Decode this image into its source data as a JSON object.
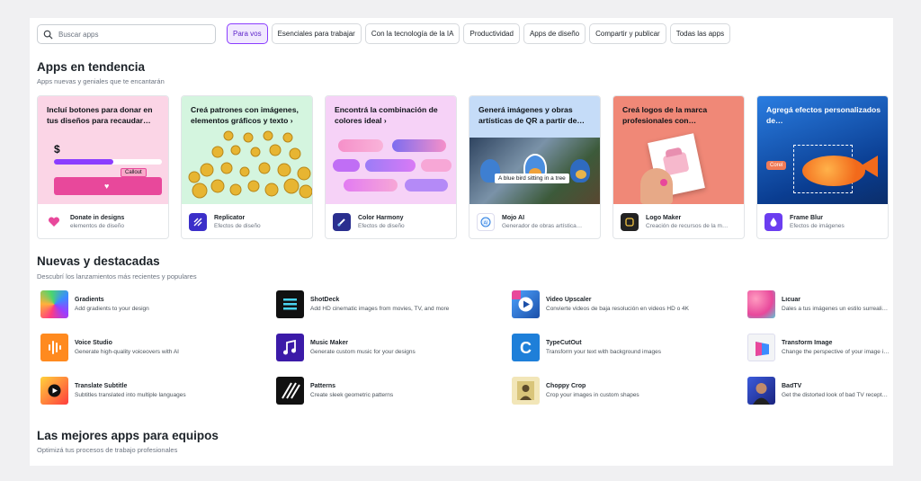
{
  "search": {
    "placeholder": "Buscar apps"
  },
  "filters": [
    {
      "label": "Para vos",
      "active": true
    },
    {
      "label": "Esenciales para trabajar",
      "active": false
    },
    {
      "label": "Con la tecnología de la IA",
      "active": false
    },
    {
      "label": "Productividad",
      "active": false
    },
    {
      "label": "Apps de diseño",
      "active": false
    },
    {
      "label": "Compartir y publicar",
      "active": false
    },
    {
      "label": "Todas las apps",
      "active": false
    }
  ],
  "trending": {
    "title": "Apps en tendencia",
    "subtitle": "Apps nuevas y geniales que te encantarán",
    "cards": [
      {
        "headline": "Incluí botones para donar en tus diseños para recaudar…",
        "name": "Donate in designs",
        "description": "elementos de diseño",
        "art_text": "$",
        "badge": "Callout",
        "bg": "#fbd5e6"
      },
      {
        "headline": "Creá patrones con imágenes, elementos gráficos y texto ›",
        "name": "Replicator",
        "description": "Efectos de diseño",
        "bg": "#d4f5df"
      },
      {
        "headline": "Encontrá la combinación de colores ideal ›",
        "name": "Color Harmony",
        "description": "Efectos de diseño",
        "bg": "#f6d2f7"
      },
      {
        "headline": "Generá imágenes y obras artísticas de QR a partir de…",
        "name": "Mojo AI",
        "description": "Generador de obras artística…",
        "prompt": "A blue bird sitting in a tree",
        "bg": "#c5dcf8"
      },
      {
        "headline": "Creá logos de la marca profesionales con…",
        "name": "Logo Maker",
        "description": "Creación de recursos de la m…",
        "bg": "#f08877"
      },
      {
        "headline": "Agregá efectos personalizados de…",
        "name": "Frame Blur",
        "description": "Efectos de imágenes",
        "badge": "Corel",
        "bg": "#1f6fd0"
      }
    ]
  },
  "featured": {
    "title": "Nuevas y destacadas",
    "subtitle": "Descubrí los lanzamientos más recientes y populares",
    "items": [
      {
        "name": "Gradients",
        "description": "Add gradients to your design"
      },
      {
        "name": "ShotDeck",
        "description": "Add HD cinematic images from movies, TV, and more"
      },
      {
        "name": "Video Upscaler",
        "description": "Convierte videos de baja resolución en videos HD o 4K"
      },
      {
        "name": "Licuar",
        "description": "Dales a tus imágenes un estilo surreali…"
      },
      {
        "name": "Voice Studio",
        "description": "Generate high-quality voiceovers with AI"
      },
      {
        "name": "Music Maker",
        "description": "Generate custom music for your designs"
      },
      {
        "name": "TypeCutOut",
        "description": "Transform your text with background images"
      },
      {
        "name": "Transform Image",
        "description": "Change the perspective of your image i…"
      },
      {
        "name": "Translate Subtitle",
        "description": "Subtitles translated into multiple languages"
      },
      {
        "name": "Patterns",
        "description": "Create sleek geometric patterns"
      },
      {
        "name": "Choppy Crop",
        "description": "Crop your images in custom shapes"
      },
      {
        "name": "BadTV",
        "description": "Get the distorted look of bad TV recept…"
      }
    ]
  },
  "teams": {
    "title": "Las mejores apps para equipos",
    "subtitle": "Optimizá tus procesos de trabajo profesionales"
  }
}
